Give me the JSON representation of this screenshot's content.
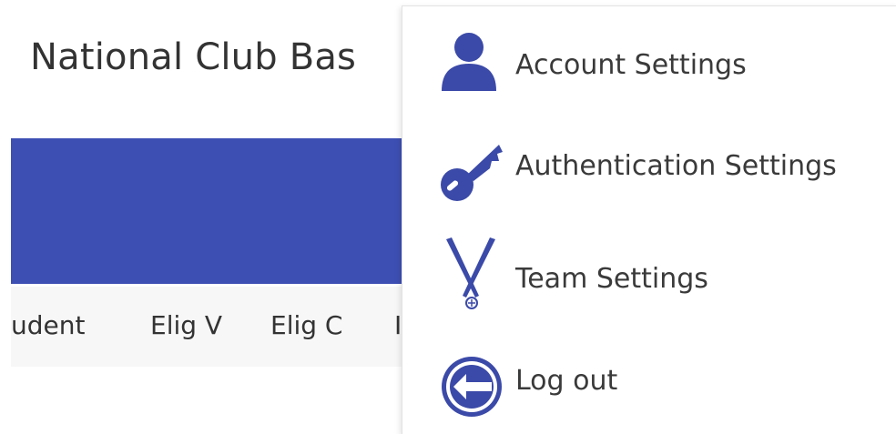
{
  "header": {
    "title": "National Club Bas"
  },
  "nav": {
    "columns": [
      "udent",
      "Elig V",
      "Elig C",
      "I"
    ]
  },
  "colors": {
    "brand": "#3d4fb3",
    "icon": "#3b4aa8"
  },
  "menu": {
    "items": [
      {
        "label": "Account Settings",
        "icon": "user-icon"
      },
      {
        "label": "Authentication Settings",
        "icon": "key-icon"
      },
      {
        "label": "Team Settings",
        "icon": "crossed-bats-icon"
      },
      {
        "label": "Log out",
        "icon": "logout-icon"
      }
    ]
  }
}
